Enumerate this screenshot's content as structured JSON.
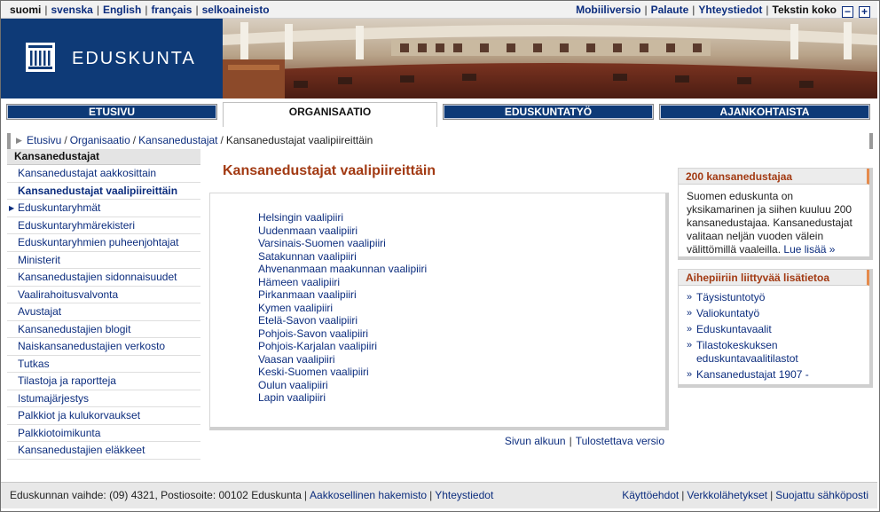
{
  "languages": [
    {
      "label": "suomi",
      "current": true
    },
    {
      "label": "svenska",
      "current": false
    },
    {
      "label": "English",
      "current": false
    },
    {
      "label": "français",
      "current": false
    },
    {
      "label": "selkoaineisto",
      "current": false
    }
  ],
  "toplinks": {
    "mobile": "Mobiiliversio",
    "feedback": "Palaute",
    "contact": "Yhteystiedot",
    "text_size_label": "Tekstin koko",
    "decrease": "−",
    "increase": "+"
  },
  "brand": {
    "name": "EDUSKUNTA",
    "logo_color": "#0e3a77"
  },
  "tabs": [
    {
      "label": "ETUSIVU",
      "active": false
    },
    {
      "label": "ORGANISAATIO",
      "active": true
    },
    {
      "label": "EDUSKUNTATYÖ",
      "active": false
    },
    {
      "label": "AJANKOHTAISTA",
      "active": false
    }
  ],
  "breadcrumb": {
    "items": [
      "Etusivu",
      "Organisaatio",
      "Kansanedustajat"
    ],
    "current": "Kansanedustajat vaalipiireittäin",
    "separator": "/"
  },
  "sidebar": {
    "heading": "Kansanedustajat",
    "items": [
      {
        "label": "Kansanedustajat aakkosittain",
        "active": false,
        "marker": false
      },
      {
        "label": "Kansanedustajat vaalipiireittäin",
        "active": true,
        "marker": false
      },
      {
        "label": "Eduskuntaryhmät",
        "active": false,
        "marker": true
      },
      {
        "label": "Eduskuntaryhmärekisteri",
        "active": false,
        "marker": false
      },
      {
        "label": "Eduskuntaryhmien puheenjohtajat",
        "active": false,
        "marker": false
      },
      {
        "label": "Ministerit",
        "active": false,
        "marker": false
      },
      {
        "label": "Kansanedustajien sidonnaisuudet",
        "active": false,
        "marker": false
      },
      {
        "label": "Vaalirahoitusvalvonta",
        "active": false,
        "marker": false
      },
      {
        "label": "Avustajat",
        "active": false,
        "marker": false
      },
      {
        "label": "Kansanedustajien blogit",
        "active": false,
        "marker": false
      },
      {
        "label": "Naiskansanedustajien verkosto",
        "active": false,
        "marker": false
      },
      {
        "label": "Tutkas",
        "active": false,
        "marker": false
      },
      {
        "label": "Tilastoja ja raportteja",
        "active": false,
        "marker": false
      },
      {
        "label": "Istumajärjestys",
        "active": false,
        "marker": false
      },
      {
        "label": "Palkkiot ja kulukorvaukset",
        "active": false,
        "marker": false
      },
      {
        "label": "Palkkiotoimikunta",
        "active": false,
        "marker": false
      },
      {
        "label": "Kansanedustajien eläkkeet",
        "active": false,
        "marker": false
      }
    ]
  },
  "main": {
    "title": "Kansanedustajat vaalipiireittäin",
    "districts": [
      "Helsingin vaalipiiri",
      "Uudenmaan vaalipiiri",
      "Varsinais-Suomen vaalipiiri",
      "Satakunnan vaalipiiri",
      "Ahvenanmaan maakunnan vaalipiiri",
      "Hämeen vaalipiiri",
      "Pirkanmaan vaalipiiri",
      "Kymen vaalipiiri",
      "Etelä-Savon vaalipiiri",
      "Pohjois-Savon vaalipiiri",
      "Pohjois-Karjalan vaalipiiri",
      "Vaasan vaalipiiri",
      "Keski-Suomen vaalipiiri",
      "Oulun vaalipiiri",
      "Lapin vaalipiiri"
    ],
    "page_top": "Sivun alkuun",
    "print_version": "Tulostettava versio"
  },
  "info_box": {
    "heading": "200 kansanedustajaa",
    "text": "Suomen eduskunta on yksikamarinen ja siihen kuuluu 200 kansanedustajaa. Kansanedustajat valitaan neljän vuoden välein välittömillä vaaleilla.",
    "more": "Lue lisää »"
  },
  "related_box": {
    "heading": "Aihepiiriin liittyvää lisätietoa",
    "bullet": "»",
    "items": [
      "Täysistuntotyö",
      "Valiokuntatyö",
      "Eduskuntavaalit",
      "Tilastokeskuksen eduskuntavaalitilastot",
      "Kansanedustajat 1907 -"
    ]
  },
  "footer": {
    "info": "Eduskunnan vaihde: (09) 4321, Postiosoite: 00102 Eduskunta",
    "index": "Aakkosellinen hakemisto",
    "contact": "Yhteystiedot",
    "terms": "Käyttöehdot",
    "webcasts": "Verkkolähetykset",
    "secure_mail": "Suojattu sähköposti"
  },
  "colors": {
    "navy": "#0e3a77",
    "link": "#0c2d7e",
    "heading_red": "#a23a13",
    "accent_orange": "#e58a4b"
  }
}
